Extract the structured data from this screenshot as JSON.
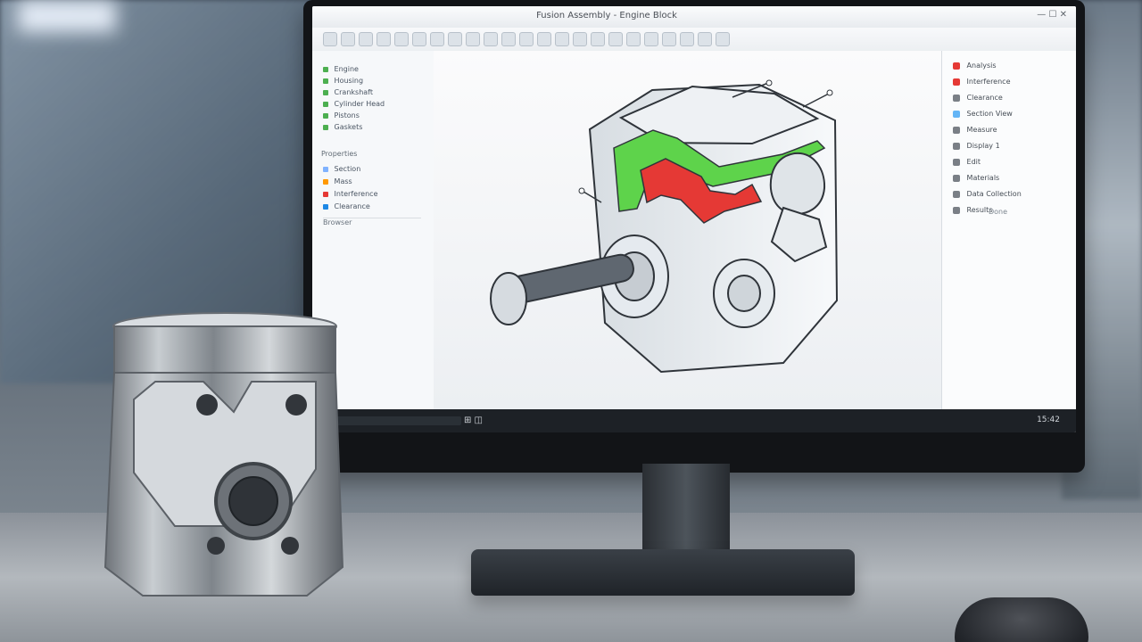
{
  "window": {
    "title": "Fusion Assembly - Engine Block",
    "controls": "— ☐ ✕"
  },
  "left_panel": {
    "tree_items": [
      {
        "label": "Engine",
        "color": "#4caf50"
      },
      {
        "label": "Housing",
        "color": "#4caf50"
      },
      {
        "label": "Crankshaft",
        "color": "#4caf50"
      },
      {
        "label": "Cylinder Head",
        "color": "#4caf50"
      },
      {
        "label": "Pistons",
        "color": "#4caf50"
      },
      {
        "label": "Gaskets",
        "color": "#4caf50"
      }
    ],
    "properties_header": "Properties",
    "properties": [
      {
        "label": "Section",
        "color": "#7fb2ff"
      },
      {
        "label": "Mass",
        "color": "#ff9800"
      },
      {
        "label": "Interference",
        "color": "#e53935"
      },
      {
        "label": "Clearance",
        "color": "#1e88e5"
      }
    ],
    "footer": "Browser"
  },
  "right_panel": {
    "items": [
      {
        "label": "Analysis",
        "icon": "#e53935"
      },
      {
        "label": "Interference",
        "icon": "#e53935"
      },
      {
        "label": "Clearance",
        "icon": "#7a7f86"
      },
      {
        "label": "Section View",
        "icon": "#64b5f6"
      },
      {
        "label": "Measure",
        "icon": "#7a7f86"
      },
      {
        "label": "Display 1",
        "icon": "#7a7f86"
      },
      {
        "label": "Edit",
        "icon": "#7a7f86"
      },
      {
        "label": "Materials",
        "icon": "#7a7f86"
      },
      {
        "label": "Data Collection",
        "icon": "#7a7f86"
      },
      {
        "label": "Results",
        "icon": "#7a7f86"
      }
    ],
    "footer": "Done"
  },
  "status": {
    "left_placeholder": "",
    "icons": "⊞ ◫",
    "right_text": "15:42"
  },
  "colors": {
    "accent_red": "#e53935",
    "accent_green": "#4caf50",
    "screen_bg": "#f3f5f7"
  }
}
